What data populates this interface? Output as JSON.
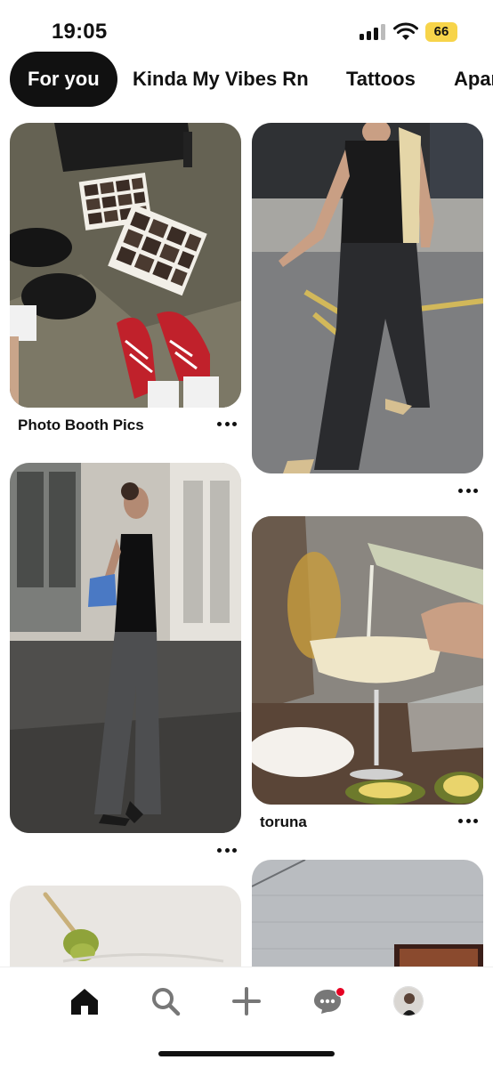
{
  "status_bar": {
    "time": "19:05",
    "battery": "66",
    "battery_color": "#f7d44a"
  },
  "tabs": [
    {
      "label": "For you",
      "active": true
    },
    {
      "label": "Kinda My Vibes Rn",
      "active": false
    },
    {
      "label": "Tattoos",
      "active": false
    },
    {
      "label": "Apar",
      "active": false
    }
  ],
  "pins": [
    {
      "title": "Photo Booth Pics",
      "image": "photo-booth-strips-shoes"
    },
    {
      "title": "",
      "image": "woman-walking-black-outfit"
    },
    {
      "title": "",
      "image": "woman-black-top-blue-bag"
    },
    {
      "title": "toruna",
      "image": "champagne-pour"
    },
    {
      "title": "",
      "image": "olive-cocktail"
    },
    {
      "title": "",
      "image": "grey-wall-sign"
    }
  ],
  "bottom_nav": {
    "items": [
      {
        "icon": "home-icon",
        "active": true
      },
      {
        "icon": "search-icon"
      },
      {
        "icon": "plus-icon"
      },
      {
        "icon": "messages-icon",
        "badge": true
      },
      {
        "icon": "profile-avatar"
      }
    ]
  },
  "colors": {
    "accent": "#e60023",
    "active_tab_bg": "#111111"
  }
}
